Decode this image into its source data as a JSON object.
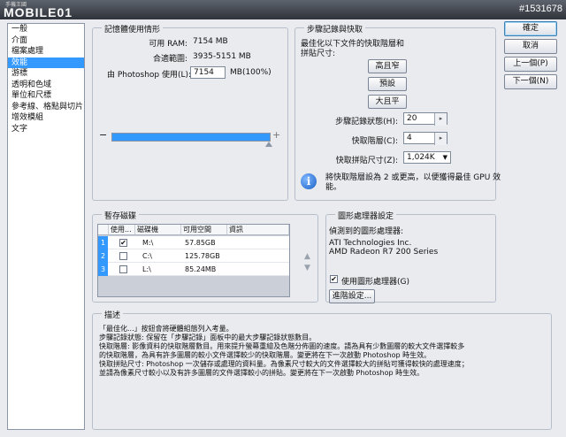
{
  "watermark": {
    "logo": "MOBILE01",
    "logo_sub": "手機王國",
    "id": "#1531678"
  },
  "sidebar": {
    "items": [
      "一般",
      "介面",
      "檔案處理",
      "效能",
      "游標",
      "透明和色域",
      "單位和尺標",
      "參考線、格點與切片",
      "增效模組",
      "文字"
    ],
    "selected_index": 3
  },
  "memory": {
    "legend": "記憶體使用情形",
    "available_label": "可用 RAM:",
    "available_value": "7154 MB",
    "ideal_label": "合適範圍:",
    "ideal_value": "3935-5151 MB",
    "usage_label": "由 Photoshop 使用(L):",
    "usage_value": "7154",
    "usage_suffix": "MB(100%)",
    "slider_percent": 100,
    "minus": "−",
    "plus": "+"
  },
  "history": {
    "legend": "步驟記錄與快取",
    "optimize_text_1": "最佳化以下文件的快取階層和",
    "optimize_text_2": "拼貼尺寸:",
    "btn_tall": "高且窄",
    "btn_default": "預設",
    "btn_big": "大且平",
    "states_label": "步驟記錄狀態(H):",
    "states_value": "20",
    "cache_levels_label": "快取階層(C):",
    "cache_levels_value": "4",
    "tile_size_label": "快取拼貼尺寸(Z):",
    "tile_size_value": "1,024K",
    "info_text_1": "將快取階層設為 2 或更高，以便獲得最佳 GPU 效",
    "info_text_2": "能。"
  },
  "scratch": {
    "legend": "暫存磁碟",
    "headers": [
      "使用...",
      "磁碟機",
      "可用空間",
      "資訊"
    ],
    "rows": [
      {
        "num": "1",
        "checked": true,
        "drive": "M:\\",
        "free": "57.85GB",
        "info": ""
      },
      {
        "num": "2",
        "checked": false,
        "drive": "C:\\",
        "free": "125.78GB",
        "info": ""
      },
      {
        "num": "3",
        "checked": false,
        "drive": "L:\\",
        "free": "85.24MB",
        "info": ""
      }
    ],
    "check_glyph": "✔",
    "up_arrow": "▲",
    "down_arrow": "▼"
  },
  "gpu": {
    "legend": "圖形處理器設定",
    "detected_label": "偵測到的圖形處理器:",
    "vendor": "ATI Technologies Inc.",
    "model": "AMD Radeon R7 200 Series",
    "use_gpu_label": "使用圖形處理器(G)",
    "use_gpu_checked": true,
    "advanced_button": "進階設定...",
    "check_glyph": "✔"
  },
  "description": {
    "legend": "描述",
    "lines": [
      "「最佳化...」按鈕會將硬體組態列入考量。",
      "步驟記錄狀態: 保留在「步驟記錄」面板中的最大步驟記錄狀態數目。",
      "快取階層: 影像資料的快取階層數目。用來提升螢幕重繪及色階分佈圖的速度。請為具有少數圖層的較大文件選擇較多",
      "的快取階層，為具有許多圖層的較小文件選擇較少的快取階層。變更將在下一次啟動 Photoshop 時生效。",
      "快取拼貼尺寸: Photoshop 一次儲存或處理的資料量。為像素尺寸較大的文件選擇較大的拼貼可獲得較快的處理速度；",
      "並請為像素尺寸較小以及有許多圖層的文件選擇較小的拼貼。變更將在下一次啟動 Photoshop 時生效。"
    ]
  },
  "buttons": {
    "ok": "確定",
    "cancel": "取消",
    "prev": "上一個(P)",
    "next": "下一個(N)"
  },
  "colors": {
    "accent": "#3399ff",
    "background": "#e9ebef"
  },
  "icons": {
    "info": "info-icon",
    "spin": "spin-arrow-icon",
    "dropdown": "chevron-down-icon"
  }
}
